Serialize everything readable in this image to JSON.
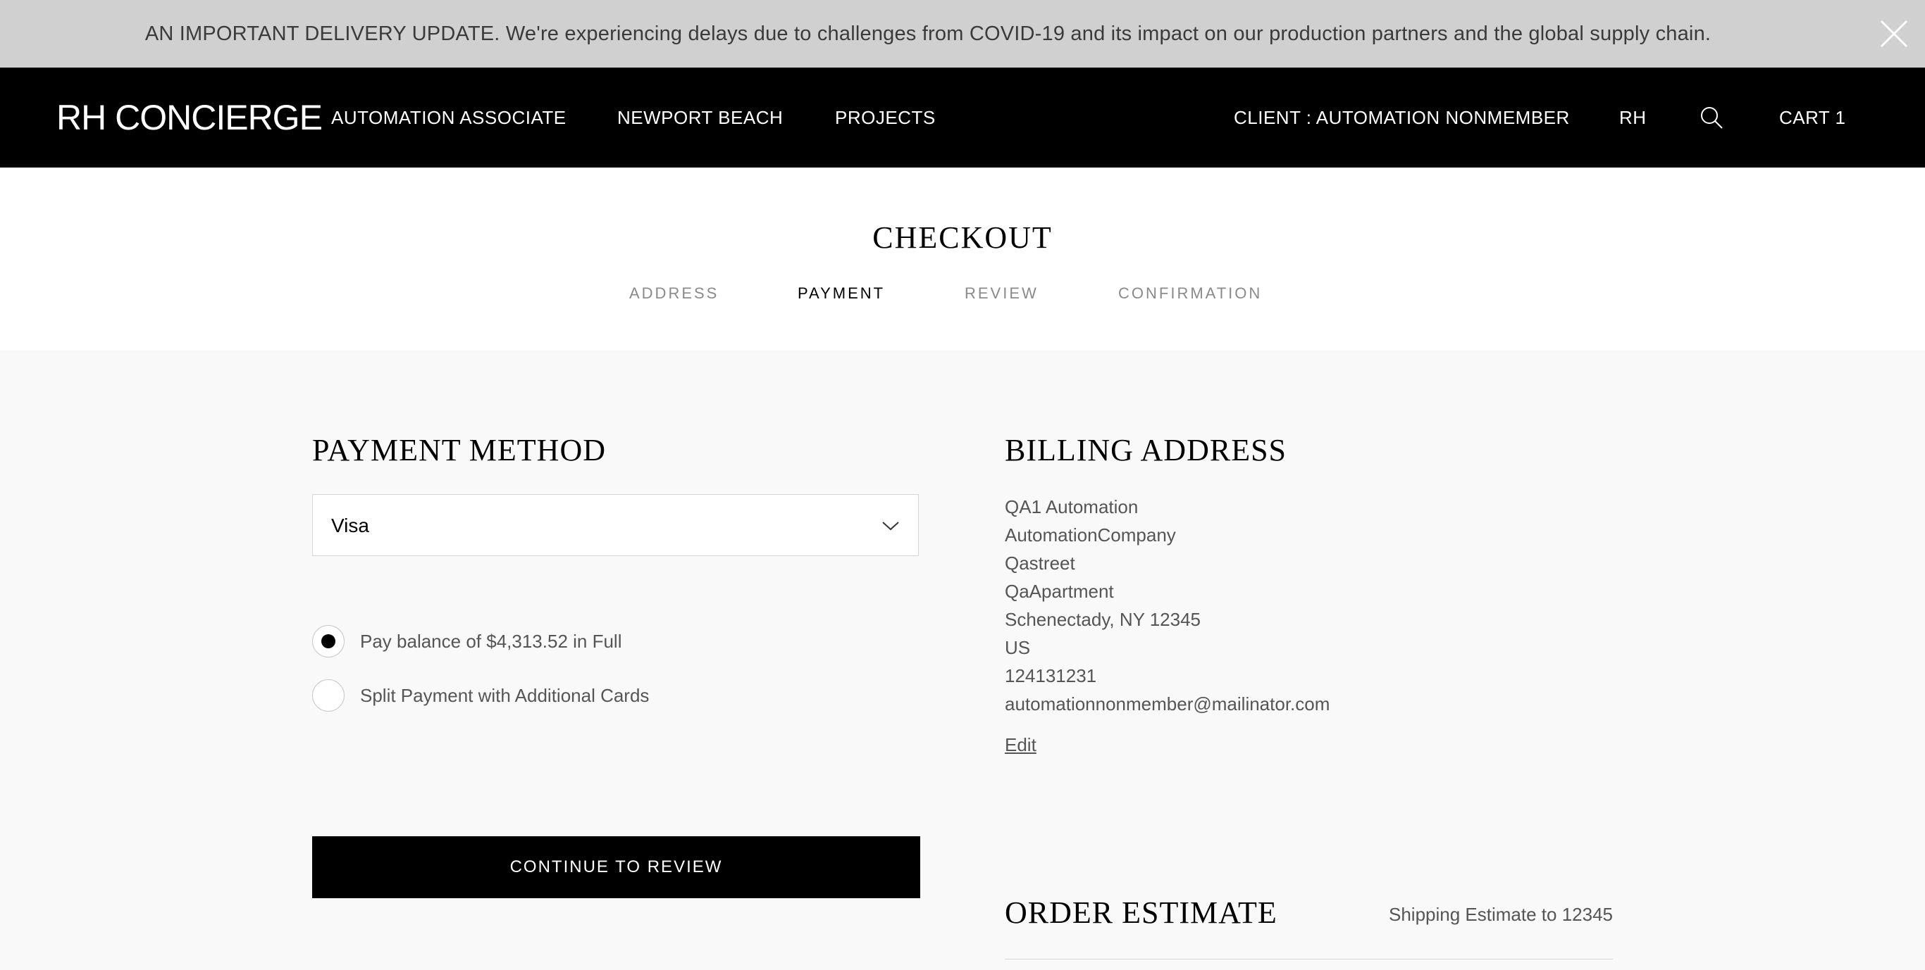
{
  "banner": {
    "text": "AN IMPORTANT DELIVERY UPDATE. We're experiencing delays due to challenges from COVID-19 and its impact on our production partners and the global supply chain.",
    "close_icon": "close-icon",
    "background": "#d0d0d0"
  },
  "nav": {
    "logo": "RH CONCIERGE",
    "items": [
      "AUTOMATION ASSOCIATE",
      "NEWPORT BEACH",
      "PROJECTS"
    ],
    "client": "CLIENT : AUTOMATION NONMEMBER",
    "rh": "RH",
    "search_icon": "search-icon",
    "cart": "CART 1",
    "background": "#000000"
  },
  "checkout": {
    "title": "CHECKOUT",
    "steps": [
      "ADDRESS",
      "PAYMENT",
      "REVIEW",
      "CONFIRMATION"
    ],
    "active_step": "PAYMENT"
  },
  "payment": {
    "title": "PAYMENT METHOD",
    "selected_method": "Visa",
    "options": [
      {
        "label": "Pay balance of $4,313.52 in Full",
        "selected": true
      },
      {
        "label": "Split Payment with Additional Cards",
        "selected": false
      }
    ],
    "continue_label": "CONTINUE TO REVIEW"
  },
  "billing": {
    "title": "BILLING ADDRESS",
    "lines": [
      "QA1 Automation",
      "AutomationCompany",
      "Qastreet",
      "QaApartment",
      "Schenectady, NY 12345",
      "US",
      "124131231",
      "automationnonmember@mailinator.com"
    ],
    "edit_label": "Edit"
  },
  "order": {
    "title": "ORDER ESTIMATE",
    "shipping_estimate": "Shipping Estimate to 12345"
  }
}
